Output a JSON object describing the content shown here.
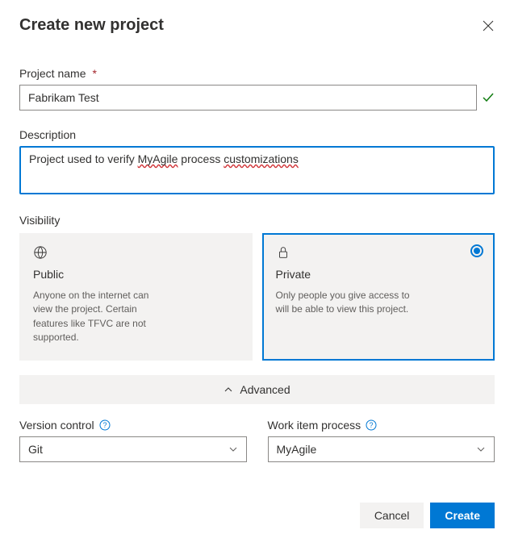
{
  "dialog": {
    "title": "Create new project"
  },
  "projectName": {
    "label": "Project name",
    "required": "*",
    "value": "Fabrikam Test",
    "valid": true
  },
  "description": {
    "label": "Description",
    "value_prefix": "Project used to verify ",
    "value_err1": "MyAgile",
    "value_mid": " process ",
    "value_err2": "customizations"
  },
  "visibility": {
    "label": "Visibility",
    "options": {
      "public": {
        "title": "Public",
        "desc": "Anyone on the internet can view the project. Certain features like TFVC are not supported."
      },
      "private": {
        "title": "Private",
        "desc": "Only people you give access to will be able to view this project.",
        "selected": true
      }
    }
  },
  "advanced": {
    "label": "Advanced"
  },
  "versionControl": {
    "label": "Version control",
    "value": "Git"
  },
  "workItemProcess": {
    "label": "Work item process",
    "value": "MyAgile"
  },
  "buttons": {
    "cancel": "Cancel",
    "create": "Create"
  }
}
